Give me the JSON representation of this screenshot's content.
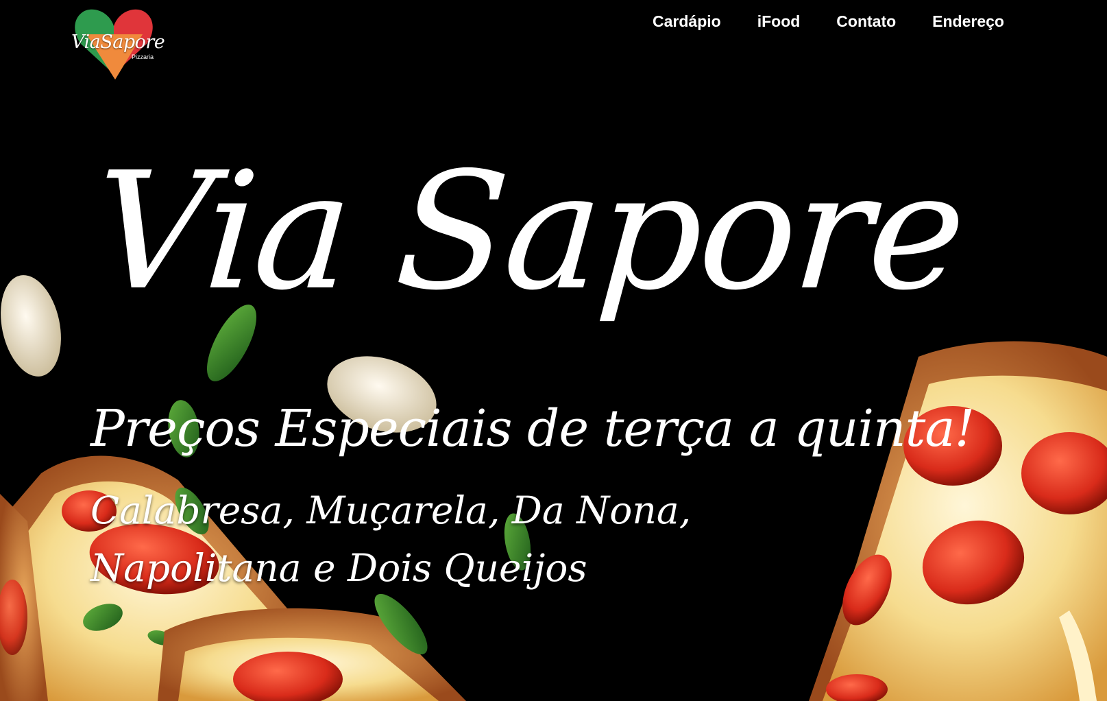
{
  "brand": {
    "logo_text": "ViaSapore",
    "logo_subtext": "Pizzaria",
    "colors": {
      "heart_green": "#2e9b4e",
      "heart_red": "#e0353a",
      "slice_orange": "#f08a3c",
      "background": "#000000",
      "text": "#ffffff"
    }
  },
  "nav": {
    "items": [
      {
        "label": "Cardápio"
      },
      {
        "label": "iFood"
      },
      {
        "label": "Contato"
      },
      {
        "label": "Endereço"
      }
    ]
  },
  "hero": {
    "title": "Via Sapore",
    "promo_headline": "Preços Especiais de terça a quinta!",
    "flavors_line1": "Calabresa, Muçarela, Da Nona,",
    "flavors_line2": "Napolitana e Dois Queijos"
  },
  "background": {
    "image_subject": "pizza slices with pepperoni, melted cheese, basil leaves and garlic on black"
  }
}
